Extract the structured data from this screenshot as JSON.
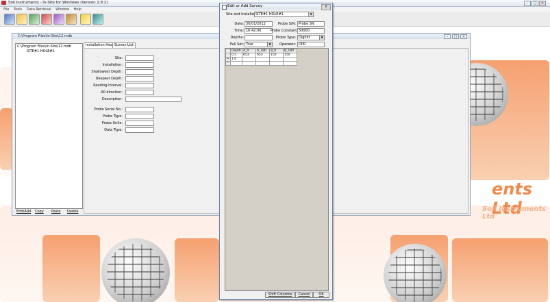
{
  "app": {
    "title": "Soil Instruments - In-Site for Windows (Version 2.8.2)",
    "menu": [
      "File",
      "Tools",
      "Data Retrieval",
      "Window",
      "Help"
    ],
    "minimize": "–",
    "maximize": "□",
    "close": "×"
  },
  "watermark": {
    "letters": "Soil",
    "ltd": "ents Ltd",
    "small": "Soil Instruments Ltd"
  },
  "child": {
    "title": "C:\\Program Files\\In-Site\\12.mdb",
    "tree": [
      "C:\\Program Files\\In-Site\\12.mdb",
      "SITE#1 HOLE#1"
    ],
    "buttons": [
      "Edit/Add",
      "Copy",
      "Paste",
      "Delete"
    ],
    "tabs": [
      "Installation Header",
      "Survey List"
    ],
    "fields": [
      "Site:",
      "Installation:",
      "Shallowest Depth:",
      "Deepest Depth:",
      "Reading Interval:",
      "A0 direction:",
      "Description:",
      "Probe Serial No.:",
      "Probe Type:",
      "Probe Units:",
      "Data Type:"
    ]
  },
  "dialog": {
    "title": "Edit or Add Survey",
    "close": "×",
    "site_label": "Site and Installation:",
    "site_value": "SITE#1 HOLE#1",
    "date_label": "Date:",
    "date_value": "30/01/2012",
    "time_label": "Time:",
    "time_value": "16:42:06",
    "depths_label": "Depths:",
    "depths_value": "",
    "fullset_label": "Full Set:",
    "fullset_value": "True",
    "probesn_label": "Probe S/N:",
    "probesn_value": "Probe SN",
    "constant_label": "Probe Constant:",
    "constant_value": "50000",
    "probetype_label": "Probe Type:",
    "probetype_value": "Digitilt",
    "operator_label": "Operator:",
    "operator_value": "DPR",
    "grid": {
      "columns": [
        "Depth",
        "A_0",
        "A_180",
        "B_0",
        "B_180"
      ],
      "rows": [
        [
          "0.5",
          "653",
          "653",
          "150",
          "150"
        ],
        [
          "1.0",
          "",
          "",
          "",
          ""
        ],
        [
          "",
          "",
          "",
          "",
          ""
        ]
      ],
      "row_markers": [
        "",
        "✎",
        "*"
      ]
    },
    "buttons": {
      "shift": "Shift Columns",
      "cancel": "Cancel",
      "ok": "OK"
    }
  }
}
